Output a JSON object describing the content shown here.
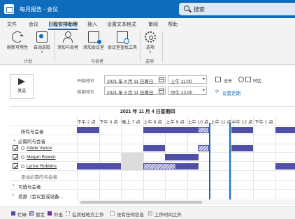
{
  "titlebar": {
    "title": "每月报告 - 会议",
    "search_placeholder": "搜索"
  },
  "tabs": [
    "文件",
    "会议",
    "日程安排助理",
    "插入",
    "设置文本格式",
    "审阅",
    "帮助"
  ],
  "ribbon": {
    "refresh": "刷新可用性",
    "autopick": "自动选取",
    "add_attendee": "添加与会者",
    "add_room": "添加会议室",
    "room_finder": "会议室查找工具",
    "options": "选项",
    "group_plan": "计划",
    "group_attendees": "与会者",
    "group_options": "选项"
  },
  "form": {
    "send": "发送",
    "start_label": "开始时间",
    "end_label": "结束时间",
    "start_date": "2021 年 4 月 11 日周日",
    "end_date": "2021 年 4 月 11 日周日",
    "start_time": "上午 11:00",
    "end_time": "中午 12:00",
    "all_day": "全天",
    "time_zone": "时区",
    "recurrence": "设置定期"
  },
  "grid": {
    "date_header": "2021 年 11 月 4 日星期四",
    "times": [
      "下午 2 点",
      "下午 3 点",
      "晚上 7 点",
      "上午 8 点",
      "上午 9 点",
      "上午 10 点",
      "上午 11 点",
      "中午 12 点",
      "下午 1 点"
    ],
    "rows": {
      "all": "所有与会者",
      "required": "必需的与会者",
      "p1": "Adele Vance",
      "p2": "Megan Bowen",
      "p3": "Lynne Robbins",
      "add_required": "添加必需的与会者",
      "optional": "可选与会者",
      "resources": "资源（会议室或设备..."
    }
  },
  "legend": [
    "忙碌",
    "暂定",
    "外出",
    "在其他地方工作",
    "没有任何信息",
    "工作时间之外"
  ],
  "colors": {
    "accent": "#0f6cbd",
    "busy": "#4f4fa7",
    "tentative_hatch": "#6b6bb7",
    "out": "#7030a0",
    "outside": "#dcdcdc"
  }
}
